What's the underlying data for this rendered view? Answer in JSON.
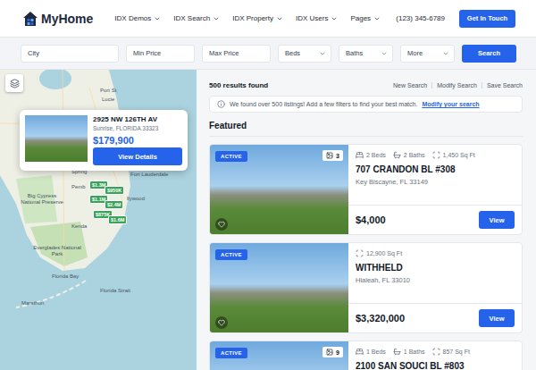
{
  "header": {
    "logo": "MyHome",
    "nav": [
      {
        "label": "IDX Demos"
      },
      {
        "label": "IDX Search"
      },
      {
        "label": "IDX Property"
      },
      {
        "label": "IDX Users"
      },
      {
        "label": "Pages"
      }
    ],
    "phone": "(123) 345-6789",
    "cta": "Get In Touch"
  },
  "search": {
    "fields": [
      {
        "placeholder": "City",
        "kind": "input"
      },
      {
        "placeholder": "Min Price",
        "kind": "input"
      },
      {
        "placeholder": "Max Price",
        "kind": "input"
      },
      {
        "placeholder": "Beds",
        "kind": "select"
      },
      {
        "placeholder": "Baths",
        "kind": "select"
      },
      {
        "placeholder": "More",
        "kind": "select"
      }
    ],
    "button": "Search"
  },
  "map": {
    "labels": [
      "Port St",
      "Lucie",
      "Fort Lauderdale",
      "Spring",
      "Pemb",
      "llywood",
      "Big Cypress National Preserve",
      "Kenda",
      "Everglades National Park",
      "Florida Bay",
      "Florida Strait",
      "Marathon"
    ],
    "pins": [
      "$1.3M",
      "$950K",
      "$1.1M",
      "$2.4M",
      "$875K",
      "$1.6M"
    ],
    "popup": {
      "address": "2925 NW 126TH AV",
      "city": "Sunrise, FLORIDA 33323",
      "price": "$179,900",
      "button": "View Details"
    }
  },
  "results": {
    "count": "500 results found",
    "links": [
      "New Search",
      "Modify Search",
      "Save Search"
    ],
    "notice": {
      "text": "We found over 500 listings! Add a few filters to find your best match.",
      "link": "Modify your search"
    },
    "heading": "Featured",
    "listings": [
      {
        "status": "ACTIVE",
        "photos": "3",
        "stats": [
          {
            "kind": "beds",
            "text": "2 Beds"
          },
          {
            "kind": "baths",
            "text": "2 Baths"
          },
          {
            "kind": "area",
            "text": "1,450 Sq Ft"
          }
        ],
        "title": "707 CRANDON BL #308",
        "location": "Key Biscayne, FL 33149",
        "price": "$4,000",
        "button": "View"
      },
      {
        "status": "ACTIVE",
        "stats": [
          {
            "kind": "area",
            "text": "12,900 Sq Ft"
          }
        ],
        "title": "WITHHELD",
        "location": "Hialeah, FL 33010",
        "price": "$3,320,000",
        "button": "View"
      },
      {
        "status": "ACTIVE",
        "photos": "9",
        "stats": [
          {
            "kind": "beds",
            "text": "1 Beds"
          },
          {
            "kind": "baths",
            "text": "1 Baths"
          },
          {
            "kind": "area",
            "text": "857 Sq Ft"
          }
        ],
        "title": "2100 SAN SOUCI BL #803"
      }
    ]
  }
}
